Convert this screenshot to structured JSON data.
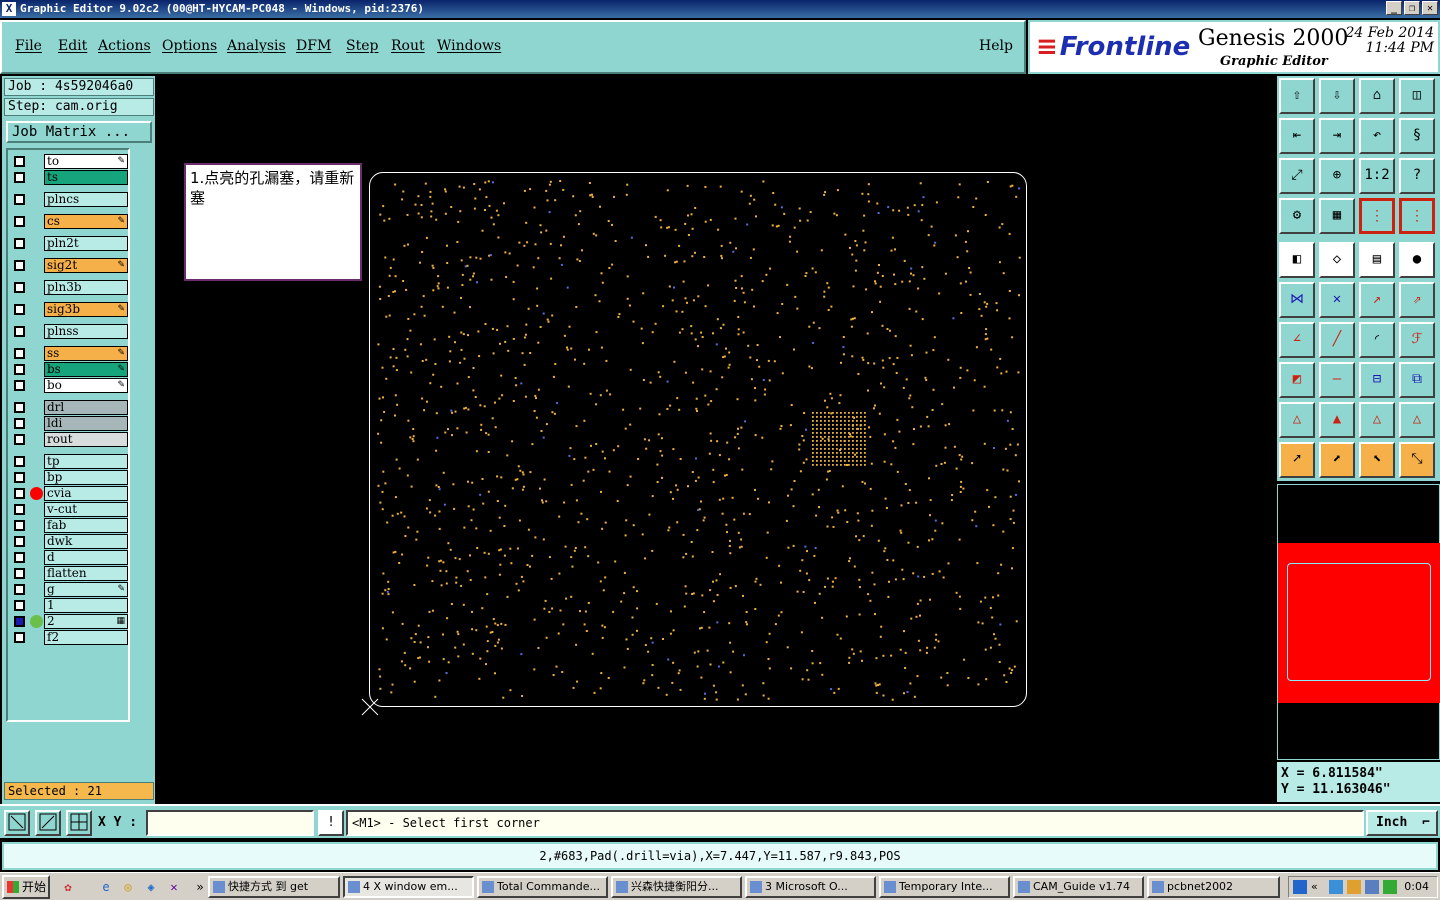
{
  "window": {
    "title": "Graphic Editor 9.02c2 (00@HT-HYCAM-PC048 - Windows, pid:2376)"
  },
  "menu": {
    "items": [
      "File",
      "Edit",
      "Actions",
      "Options",
      "Analysis",
      "DFM",
      "Step",
      "Rout",
      "Windows"
    ],
    "help": "Help"
  },
  "brand": {
    "logo": "Frontline",
    "product": "Genesis 2000",
    "subtitle": "Graphic Editor",
    "date": "24 Feb 2014",
    "time": "11:44 PM"
  },
  "job": {
    "job_line": "Job : 4s592046a0",
    "step_line": "Step: cam.orig",
    "matrix_button": "Job Matrix ..."
  },
  "layers": [
    {
      "name": "to",
      "color": "#ffffff",
      "tag": "✎"
    },
    {
      "name": "ts",
      "color": "#16a47c",
      "tag": ""
    },
    {
      "name": "plncs",
      "color": "#b8eae6",
      "tag": ""
    },
    {
      "name": "cs",
      "color": "#f6b04a",
      "tag": "✎"
    },
    {
      "name": "pln2t",
      "color": "#b8eae6",
      "tag": ""
    },
    {
      "name": "sig2t",
      "color": "#f6b04a",
      "tag": "✎"
    },
    {
      "name": "pln3b",
      "color": "#b8eae6",
      "tag": ""
    },
    {
      "name": "sig3b",
      "color": "#f6b04a",
      "tag": "✎"
    },
    {
      "name": "plnss",
      "color": "#b8eae6",
      "tag": ""
    },
    {
      "name": "ss",
      "color": "#f6b04a",
      "tag": "✎"
    },
    {
      "name": "bs",
      "color": "#16a47c",
      "tag": "✎"
    },
    {
      "name": "bo",
      "color": "#ffffff",
      "tag": "✎"
    },
    {
      "name": "drl",
      "color": "#a7b6b8",
      "tag": ""
    },
    {
      "name": "ldi",
      "color": "#a7b6b8",
      "tag": ""
    },
    {
      "name": "rout",
      "color": "#d8dcdc",
      "tag": ""
    },
    {
      "name": "tp",
      "color": "#b8eae6",
      "tag": ""
    },
    {
      "name": "bp",
      "color": "#b8eae6",
      "tag": ""
    },
    {
      "name": "cvia",
      "color": "#b8eae6",
      "tag": "",
      "marker": "#ff0000"
    },
    {
      "name": "v-cut",
      "color": "#b8eae6",
      "tag": ""
    },
    {
      "name": "fab",
      "color": "#b8eae6",
      "tag": ""
    },
    {
      "name": "dwk",
      "color": "#b8eae6",
      "tag": ""
    },
    {
      "name": "d",
      "color": "#b8eae6",
      "tag": ""
    },
    {
      "name": "flatten",
      "color": "#b8eae6",
      "tag": ""
    },
    {
      "name": "g",
      "color": "#b8eae6",
      "tag": "✎"
    },
    {
      "name": "1",
      "color": "#b8eae6",
      "tag": ""
    },
    {
      "name": "2",
      "color": "#b8eae6",
      "tag": "▦",
      "marker": "#6ac04a",
      "checked": true
    },
    {
      "name": "f2",
      "color": "#b8eae6",
      "tag": ""
    }
  ],
  "selected": "Selected : 21",
  "note": "1.点亮的孔漏塞，请重新塞",
  "canvas": {
    "pad_color": "#f0b040",
    "accent_pad_color": "#5a6adf",
    "board_outline_color": "#ffffff"
  },
  "toolbox": {
    "icons": [
      "layer-up-icon",
      "layer-down-icon",
      "home-icon",
      "window-icon",
      "pan-left-icon",
      "pan-right-icon",
      "undo-zoom-icon",
      "redraw-icon",
      "fit-icon",
      "center-icon",
      "scale-1to2-icon",
      "help-icon",
      "toolbox-icon",
      "grid-icon",
      "snap-red-icon",
      "net-red-icon",
      "fill-icon",
      "outline-icon",
      "ruler-icon",
      "dot-icon",
      "connect-icon",
      "cross-icon",
      "move-icon",
      "copy-icon",
      "angle-icon",
      "line-icon",
      "arc-icon",
      "mirror-icon",
      "transform-icon",
      "minus-icon",
      "measure-icon",
      "group-icon",
      "triangle-a-icon",
      "triangle-b-icon",
      "triangle-c-icon",
      "triangle-d-icon",
      "pointer-icon",
      "select-icon",
      "select-alt-icon",
      "net-select-icon"
    ]
  },
  "coords": {
    "x": "X = 6.811584\"",
    "y": "Y = 11.163046\""
  },
  "command": {
    "xy_label": "X Y :",
    "xy_value": "",
    "prompt": "<M1> - Select first corner",
    "unit": "Inch"
  },
  "status": "2,#683,Pad(.drill=via),X=7.447,Y=11.587,r9.843,POS",
  "taskbar": {
    "start": "开始",
    "tasks": [
      "快捷方式 到 get",
      "4 X window em...",
      "Total Commande...",
      "兴森快捷衡阳分...",
      "3 Microsoft O...",
      "Temporary Inte...",
      "CAM_Guide v1.74",
      "pcbnet2002"
    ],
    "clock": "0:04"
  }
}
